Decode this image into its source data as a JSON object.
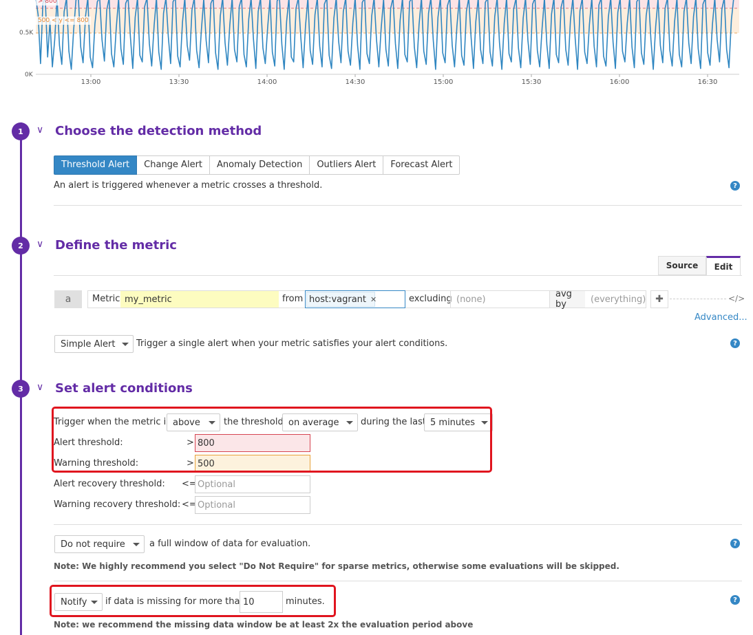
{
  "chart": {
    "y_tick_labels": [
      "0.5K",
      "0K"
    ],
    "x_tick_labels": [
      "13:00",
      "13:30",
      "14:00",
      "14:30",
      "15:00",
      "15:30",
      "16:00",
      "16:30"
    ],
    "alert_zone_label": "> 800",
    "warning_zone_label": "500 < y <= 800",
    "colors": {
      "line": "#2f86c1",
      "alert_zone": "#fbe3e6",
      "warning_zone": "#fdeedd",
      "alert_line": "#e07a7a",
      "warning_line": "#e8a760"
    }
  },
  "chart_data": {
    "type": "line",
    "xlabel": "",
    "ylabel": "",
    "x_ticks": [
      "13:00",
      "13:30",
      "14:00",
      "14:30",
      "15:00",
      "15:30",
      "16:00",
      "16:30"
    ],
    "y_ticks": [
      "0K",
      "0.5K"
    ],
    "ylim": [
      0,
      1050
    ],
    "thresholds": {
      "alert": 800,
      "warning": 500
    },
    "series": [
      {
        "values": [
          980,
          720,
          130,
          860,
          1050,
          210,
          640,
          90,
          420,
          1010,
          350,
          120,
          760,
          980,
          280,
          60,
          540,
          900,
          1030,
          330,
          140,
          700,
          950,
          210,
          80,
          610,
          880,
          1000,
          420,
          160,
          780,
          1040,
          250,
          90,
          560,
          920,
          310,
          120,
          860,
          1000,
          450,
          70,
          690,
          980,
          230,
          150,
          820,
          1040,
          370,
          100,
          590,
          930,
          270,
          60,
          740,
          1010,
          460,
          130,
          880,
          960,
          220,
          90,
          630,
          1000,
          350,
          170,
          780,
          1050,
          290,
          80,
          540,
          910,
          410,
          140,
          860,
          990,
          260,
          60,
          710,
          1030,
          380,
          110,
          600,
          940,
          300,
          150,
          820,
          1000,
          240,
          90,
          670,
          980,
          430,
          70,
          760,
          1040,
          320,
          130,
          570,
          920,
          270,
          100,
          890,
          1010,
          360,
          60,
          640,
          970,
          210,
          150,
          800,
          1050,
          450,
          80,
          590,
          930,
          290,
          120,
          720,
          1000,
          340,
          90,
          850,
          960,
          230,
          70,
          680,
          1020,
          400,
          140,
          760,
          990,
          280,
          110,
          620,
          950,
          350,
          60,
          870,
          1040,
          250,
          130,
          710,
          980,
          420,
          90,
          560,
          910,
          300,
          100,
          800,
          1010,
          370,
          70,
          650,
          960,
          240,
          150,
          880,
          1050,
          330,
          80,
          600,
          930,
          280,
          120,
          740,
          1000,
          410,
          60,
          690,
          970,
          260,
          140,
          830,
          1020,
          350,
          90,
          580,
          940,
          230,
          110,
          760,
          990,
          440,
          70,
          640,
          1050,
          300,
          130,
          870,
          960,
          270,
          100,
          700,
          1010,
          380,
          60,
          620,
          930,
          250,
          150,
          790,
          1000,
          320,
          80,
          680,
          970,
          410,
          120,
          850,
          1040,
          290,
          90,
          560,
          920,
          360,
          70,
          730,
          990,
          240,
          140,
          810,
          1050,
          300,
          110,
          660,
          950,
          430,
          60,
          770,
          1010,
          270,
          130,
          600,
          980,
          340,
          90,
          840,
          960,
          220,
          100,
          690,
          1030,
          390,
          70,
          750,
          940,
          280,
          150,
          620,
          1000,
          330,
          80,
          880,
          970,
          260,
          120,
          710,
          1050,
          420,
          60,
          580,
          910,
          350,
          140,
          800,
          990,
          290,
          100,
          640,
          1020,
          240,
          90,
          760,
          960,
          380,
          130,
          700,
          1000,
          310,
          70,
          850,
          980,
          260,
          110,
          610,
          940,
          420,
          150,
          790,
          1040,
          300,
          80,
          660,
          970
        ]
      }
    ]
  },
  "steps": [
    {
      "number": "1",
      "title": "Choose the detection method"
    },
    {
      "number": "2",
      "title": "Define the metric"
    },
    {
      "number": "3",
      "title": "Set alert conditions"
    }
  ],
  "detection": {
    "buttons": [
      "Threshold Alert",
      "Change Alert",
      "Anomaly Detection",
      "Outliers Alert",
      "Forecast Alert"
    ],
    "active": "Threshold Alert",
    "description": "An alert is triggered whenever a metric crosses a threshold."
  },
  "metric": {
    "tabs": [
      "Source",
      "Edit"
    ],
    "active_tab": "Edit",
    "query_letter": "a",
    "metric_label": "Metric",
    "metric_value": "my_metric",
    "from_label": "from",
    "from_tag": "host:vagrant",
    "excluding_label": "excluding",
    "excluding_placeholder": "(none)",
    "avg_by_label": "avg by",
    "avg_by_placeholder": "(everything)",
    "add_symbol": "✚",
    "code_symbol": "</>",
    "advanced_link": "Advanced...",
    "alert_type": "Simple Alert",
    "alert_type_description": "Trigger a single alert when your metric satisfies your alert conditions."
  },
  "conditions": {
    "trigger_prefix": "Trigger when the metric is",
    "comparison": "above",
    "the_threshold": "the threshold",
    "aggregation": "on average",
    "during_the_last": "during the last",
    "window": "5 minutes",
    "rows": [
      {
        "label": "Alert threshold:",
        "op": ">",
        "value": "800",
        "placeholder": ""
      },
      {
        "label": "Warning threshold:",
        "op": ">",
        "value": "500",
        "placeholder": ""
      },
      {
        "label": "Alert recovery threshold:",
        "op": "<=",
        "value": "",
        "placeholder": "Optional"
      },
      {
        "label": "Warning recovery threshold:",
        "op": "<=",
        "value": "",
        "placeholder": "Optional"
      }
    ],
    "require_select": "Do not require",
    "require_text": "a full window of data for evaluation.",
    "require_note": "Note: We highly recommend you select \"Do Not Require\" for sparse metrics, otherwise some evaluations will be skipped.",
    "notify_select": "Notify",
    "notify_text": "if data is missing for more than",
    "notify_minutes": "10",
    "notify_suffix": "minutes.",
    "notify_note": "Note: we recommend the missing data window be at least 2x the evaluation period above"
  }
}
